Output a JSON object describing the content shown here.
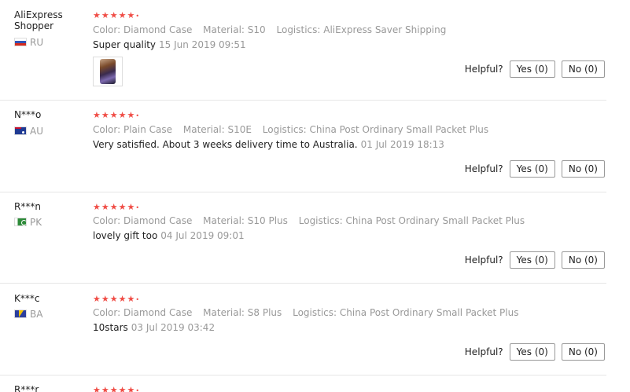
{
  "helpful_label": "Helpful?",
  "star_color": "#f04d46",
  "reviews": [
    {
      "user": "AliExpress Shopper",
      "country": "RU",
      "stars": "★★★★★",
      "attrs": [
        "Color: Diamond Case",
        "Material: S10",
        "Logistics: AliExpress Saver Shipping"
      ],
      "comment": "Super quality",
      "date": "15 Jun 2019 09:51",
      "yes": "Yes (0)",
      "no": "No (0)"
    },
    {
      "user": "N***o",
      "country": "AU",
      "stars": "★★★★★",
      "attrs": [
        "Color: Plain Case",
        "Material: S10E",
        "Logistics: China Post Ordinary Small Packet Plus"
      ],
      "comment": "Very satisfied. About 3 weeks delivery time to Australia.",
      "date": "01 Jul 2019 18:13",
      "yes": "Yes (0)",
      "no": "No (0)"
    },
    {
      "user": "R***n",
      "country": "PK",
      "stars": "★★★★★",
      "attrs": [
        "Color: Diamond Case",
        "Material: S10 Plus",
        "Logistics: China Post Ordinary Small Packet Plus"
      ],
      "comment": "lovely gift too",
      "date": "04 Jul 2019 09:01",
      "yes": "Yes (0)",
      "no": "No (0)"
    },
    {
      "user": "K***c",
      "country": "BA",
      "stars": "★★★★★",
      "attrs": [
        "Color: Diamond Case",
        "Material: S8 Plus",
        "Logistics: China Post Ordinary Small Packet Plus"
      ],
      "comment": "10stars",
      "date": "03 Jul 2019 03:42",
      "yes": "Yes (0)",
      "no": "No (0)"
    },
    {
      "user": "R***r",
      "stars": "★★★★★"
    }
  ]
}
